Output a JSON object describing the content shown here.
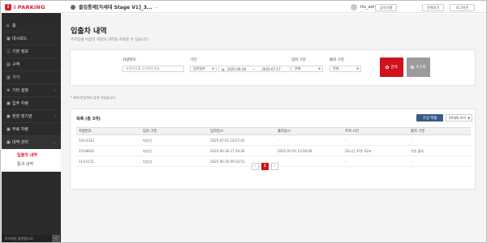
{
  "brand": {
    "name": "i PARKING",
    "mark": "i"
  },
  "sidebar": {
    "items": [
      {
        "icon": "⌂",
        "label": "홈",
        "arrow": ""
      },
      {
        "icon": "▦",
        "label": "대시보드",
        "arrow": ""
      },
      {
        "icon": "ⓘ",
        "label": "기본 정보",
        "arrow": ""
      },
      {
        "icon": "▤",
        "label": "구역",
        "arrow": ""
      },
      {
        "icon": "▥",
        "label": "기기",
        "arrow": ""
      },
      {
        "icon": "✲",
        "label": "기타 설정",
        "arrow": "›"
      },
      {
        "icon": "▣",
        "label": "입주 차량",
        "arrow": ""
      },
      {
        "icon": "▣",
        "label": "현장 정기권",
        "arrow": "›"
      },
      {
        "icon": "▣",
        "label": "무료 차량",
        "arrow": ""
      },
      {
        "icon": "▣",
        "label": "내역 관리",
        "arrow": "⌄"
      }
    ],
    "submenu": [
      {
        "label": "입출차 내역",
        "active": true
      },
      {
        "label": "통과 내역",
        "active": false
      }
    ],
    "footer": "아이파킹 플랫폼(v1)",
    "collapse": "‹"
  },
  "header": {
    "site": "출입통제[차세대 Stage V1]_3...",
    "caret": "⌄",
    "user": "tta_admin 님",
    "buttons": [
      "공지사항",
      "전체보기",
      "로그아웃"
    ]
  },
  "page": {
    "title": "입출차 내역",
    "description": "주차장을 이용한 차량의 내역을 조회할 수 있습니다."
  },
  "search": {
    "plate_label": "차량번호",
    "plate_placeholder": "차량번호를 입력해주세요",
    "period_label": "기간",
    "period_type": "입차일자",
    "date_from": "2025-06-16",
    "date_sep": "~",
    "date_to": "2025-07-17",
    "entry_type_label": "입차 구분",
    "entry_type_value": "전체",
    "exit_type_label": "출차 구분",
    "exit_type_value": "전체",
    "search_button": "검색",
    "reset_button": "초기화"
  },
  "note": "* 최대 한달까지 검색 가능합니다.",
  "list": {
    "title": "목록 (총 3개)",
    "excel_button": "수입 엑셀",
    "page_size": "20개씩 보기",
    "columns": [
      "차량번호",
      "입차 구분",
      "입차일시",
      "출차일시",
      "주차 시간",
      "출차 구분"
    ],
    "rows": [
      [
        "33가3333",
        "미승인",
        "2025-07-01 18:57:02",
        "-",
        "-",
        "-"
      ],
      [
        "25가8620",
        "미승인",
        "2025-06-30 17:10:26",
        "2025-07-01 13:58:08",
        "20시간 37분 42초",
        "수동 출차"
      ],
      [
        "11가1111",
        "미승인",
        "2025-06-30 09:32:51",
        "-",
        "-",
        "-"
      ]
    ]
  },
  "pagination": {
    "prev": "‹",
    "current": "1",
    "next": "›"
  }
}
